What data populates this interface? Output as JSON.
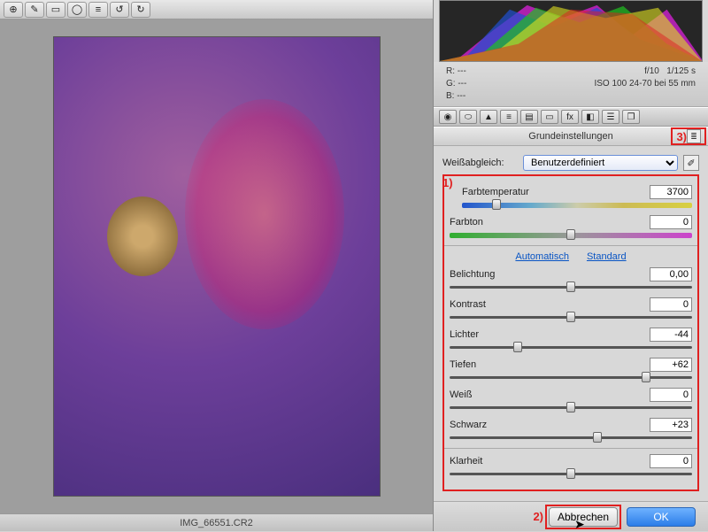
{
  "filename": "IMG_66551.CR2",
  "readout": {
    "r": "R:   ---",
    "g": "G:   ---",
    "b": "B:   ---",
    "aperture": "f/10",
    "shutter": "1/125 s",
    "iso_lens": "ISO 100   24-70 bei 55 mm"
  },
  "panel_title": "Grundeinstellungen",
  "wb": {
    "label": "Weißabgleich:",
    "value": "Benutzerdefiniert"
  },
  "links": {
    "auto": "Automatisch",
    "standard": "Standard"
  },
  "sliders": {
    "temp": {
      "label": "Farbtemperatur",
      "value": "3700",
      "pos": 15
    },
    "tint": {
      "label": "Farbton",
      "value": "0",
      "pos": 50
    },
    "exposure": {
      "label": "Belichtung",
      "value": "0,00",
      "pos": 50
    },
    "contrast": {
      "label": "Kontrast",
      "value": "0",
      "pos": 50
    },
    "highlights": {
      "label": "Lichter",
      "value": "-44",
      "pos": 28
    },
    "shadows": {
      "label": "Tiefen",
      "value": "+62",
      "pos": 81
    },
    "whites": {
      "label": "Weiß",
      "value": "0",
      "pos": 50
    },
    "blacks": {
      "label": "Schwarz",
      "value": "+23",
      "pos": 61
    },
    "clarity": {
      "label": "Klarheit",
      "value": "0",
      "pos": 50
    }
  },
  "buttons": {
    "cancel": "Abbrechen",
    "ok": "OK"
  },
  "annotations": {
    "one": "1)",
    "two": "2)",
    "three": "3)"
  }
}
